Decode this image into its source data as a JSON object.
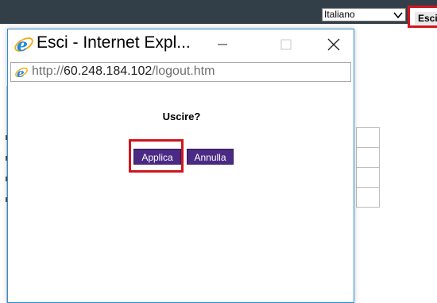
{
  "background_page": {
    "language_select": {
      "value": "Italiano"
    },
    "logout_button": {
      "label": "Esci"
    }
  },
  "popup": {
    "title": "Esci - Internet Expl...",
    "address": {
      "prefix": "http://",
      "host": "60.248.184.102",
      "path": "/logout.htm"
    },
    "question": "Uscire?",
    "buttons": {
      "apply_label": "Applica",
      "cancel_label": "Annulla"
    }
  },
  "colors": {
    "topbar": "#333f48",
    "button": "#4b2a84",
    "highlight": "#d0161e",
    "ie_blue": "#1e88e5"
  },
  "icons": [
    "ie-logo-icon",
    "chevron-down-icon",
    "minimize-icon",
    "maximize-icon",
    "close-icon"
  ]
}
